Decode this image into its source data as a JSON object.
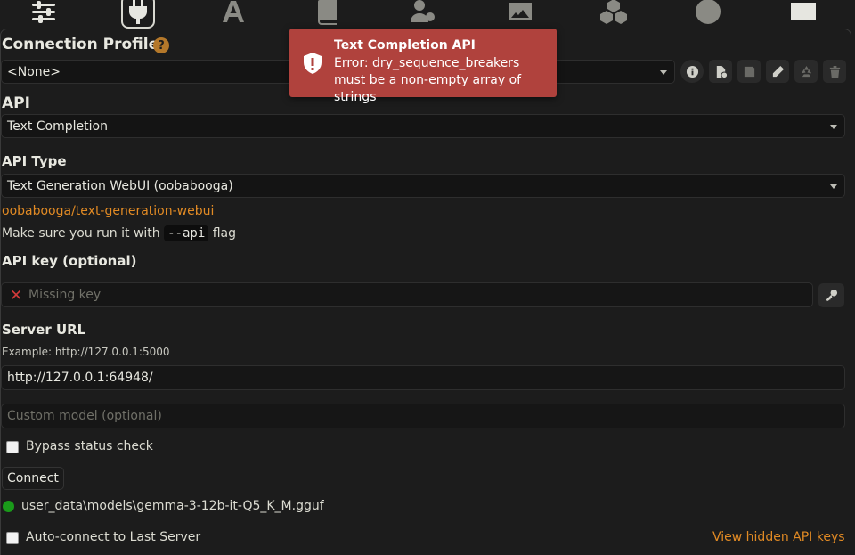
{
  "topbar": {
    "icons": [
      "sliders-icon",
      "plug-icon",
      "font-icon",
      "book-globe-icon",
      "user-gear-icon",
      "image-icon",
      "cubes-icon",
      "smile-icon",
      "id-card-icon"
    ],
    "active": "plug-icon"
  },
  "connection_profile": {
    "title": "Connection Profile",
    "help": "?",
    "selected": "<None>"
  },
  "api": {
    "label": "API",
    "selected": "Text Completion"
  },
  "api_type": {
    "label": "API Type",
    "selected": "Text Generation WebUI (oobabooga)",
    "link_text": "oobabooga/text-generation-webui",
    "hint_prefix": "Make sure you run it with",
    "hint_code": "--api",
    "hint_suffix": "flag"
  },
  "api_key": {
    "label": "API key (optional)",
    "placeholder": "Missing key"
  },
  "server_url": {
    "label": "Server URL",
    "example": "Example: http://127.0.0.1:5000",
    "value": "http://127.0.0.1:64948/",
    "custom_model_placeholder": "Custom model (optional)"
  },
  "bypass": {
    "label": "Bypass status check",
    "checked": false
  },
  "connect_button": "Connect",
  "status": {
    "model": "user_data\\models\\gemma-3-12b-it-Q5_K_M.gguf",
    "color": "#1a9a1a"
  },
  "auto_connect": {
    "label": "Auto-connect to Last Server",
    "checked": false
  },
  "view_hidden_keys": "View hidden API keys",
  "toast": {
    "title": "Text Completion API",
    "message": "Error: dry_sequence_breakers must be a non-empty array of strings",
    "color": "#b0423d"
  }
}
